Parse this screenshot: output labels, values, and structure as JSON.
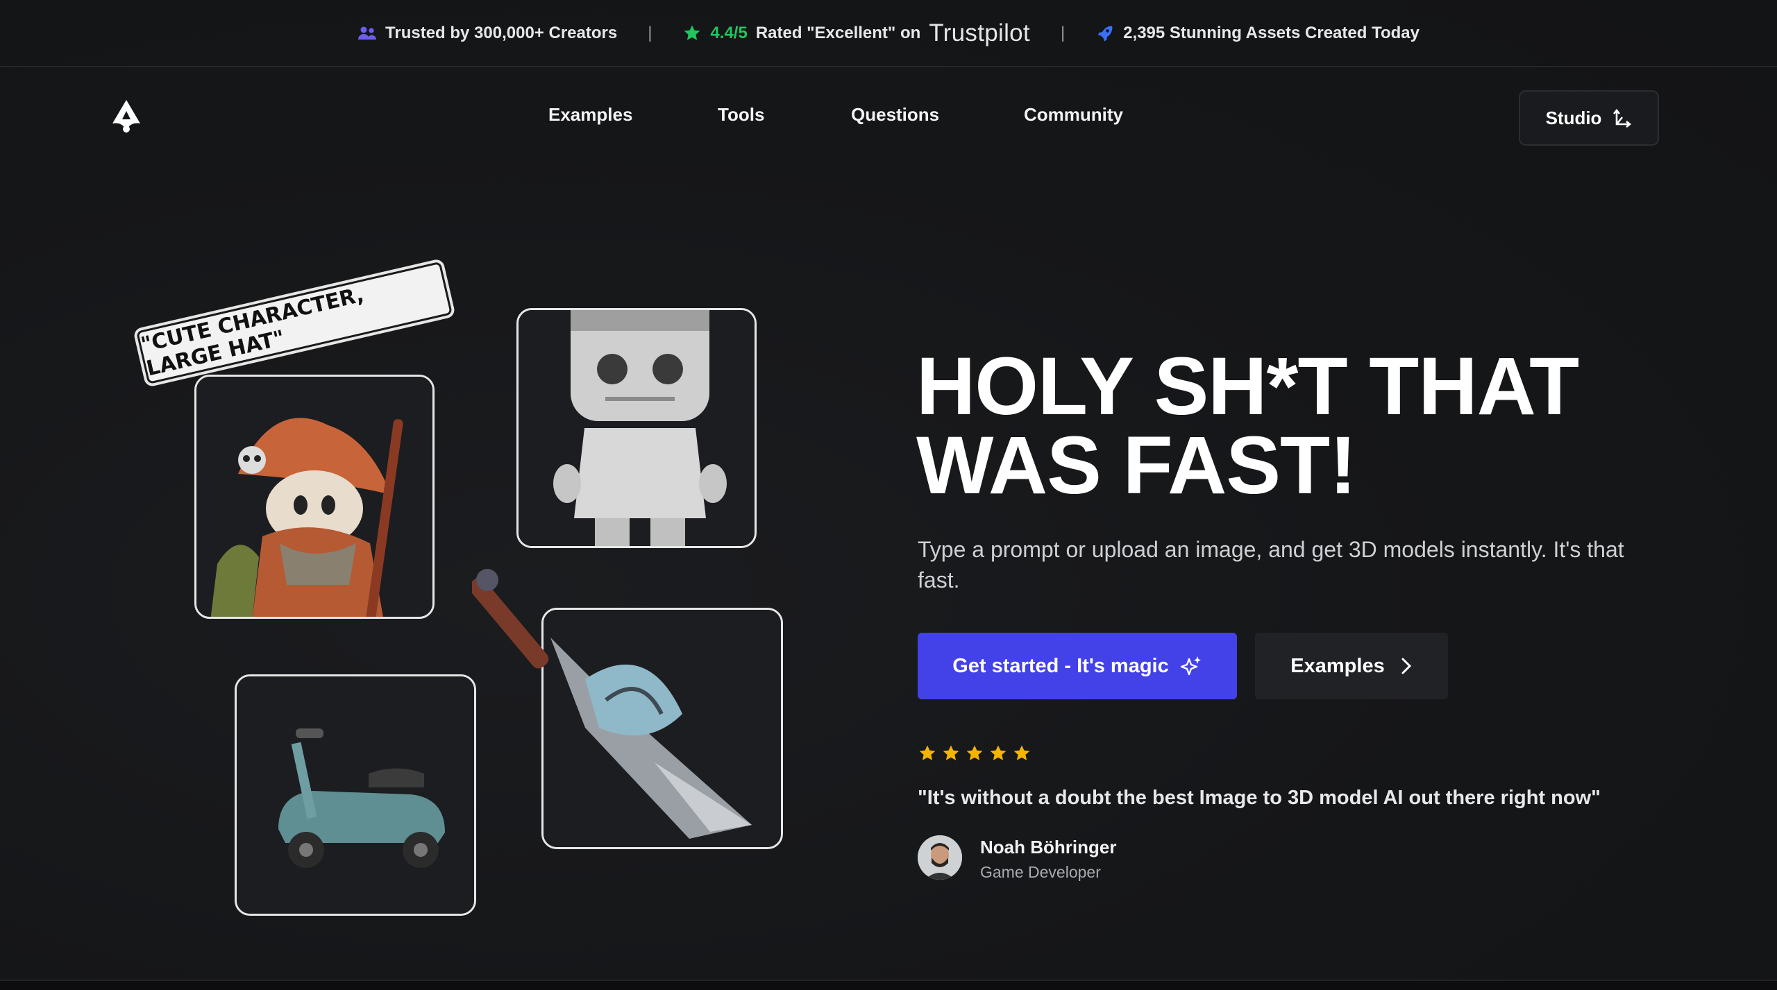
{
  "topbar": {
    "trusted": "Trusted by 300,000+ Creators",
    "separator": "|",
    "rating": "4.4/5",
    "rated_text": "Rated \"Excellent\" on",
    "brand": "Trustpilot",
    "assets": "2,395 Stunning Assets Created Today"
  },
  "nav": {
    "items": [
      {
        "label": "Examples"
      },
      {
        "label": "Tools"
      },
      {
        "label": "Questions"
      },
      {
        "label": "Community"
      }
    ],
    "studio_label": "Studio"
  },
  "collage": {
    "prompt_tag": "\"CUTE CHARACTER, LARGE HAT\""
  },
  "hero": {
    "title_line1": "HOLY SH*T THAT",
    "title_line2": "WAS FAST!",
    "subtitle": "Type a prompt or upload an image, and get 3D models instantly. It's that fast.",
    "cta_primary": "Get started - It's magic",
    "cta_secondary": "Examples"
  },
  "testimonial": {
    "stars": 5,
    "quote": "\"It's without a doubt the best Image to 3D model AI out there right now\"",
    "author_name": "Noah Böhringer",
    "author_role": "Game Developer"
  },
  "colors": {
    "accent": "#4341e8",
    "rating_green": "#22c55e",
    "star_gold": "#f5b400",
    "rocket_blue": "#3b6ff5",
    "users_icon": "#6d5ef0"
  },
  "icons": {
    "users": "users-icon",
    "star": "star-icon",
    "rocket": "rocket-icon",
    "logo": "logo-icon",
    "studio": "axis-arrows-icon",
    "sparkle": "sparkle-icon",
    "chevron": "chevron-right-icon"
  }
}
